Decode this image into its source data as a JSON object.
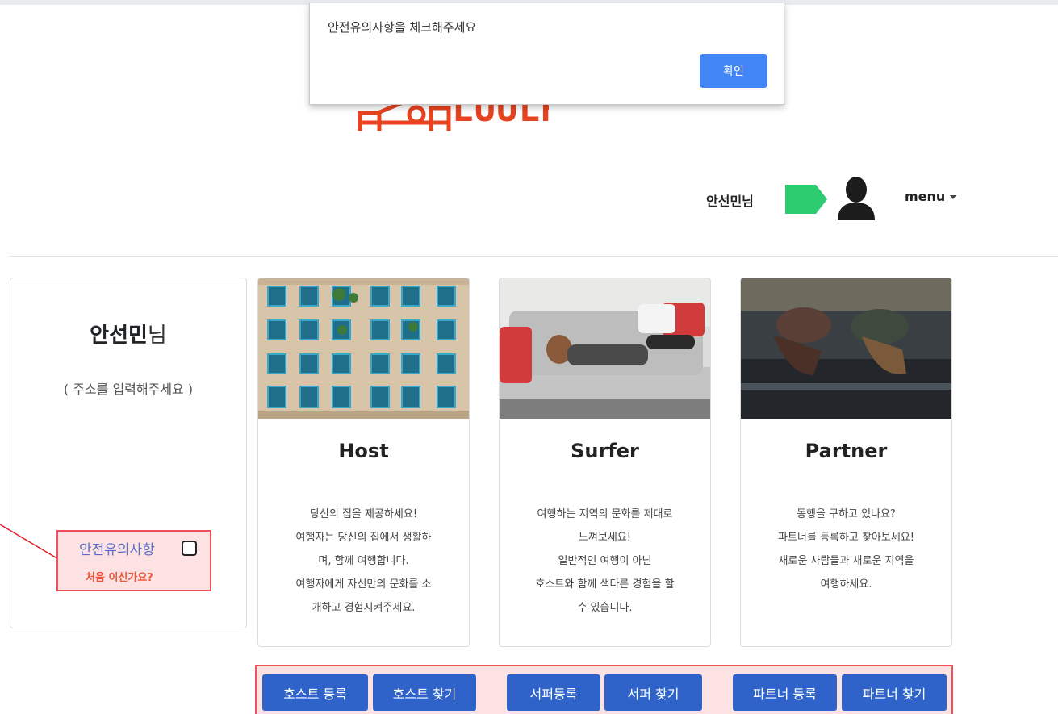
{
  "alert": {
    "message": "안전유의사항을 체크해주세요",
    "ok_label": "확인"
  },
  "logo": {
    "text": "LUULH"
  },
  "user_bar": {
    "user_name": "안선민님",
    "menu_label": "menu"
  },
  "profile": {
    "name": "안선민",
    "name_suffix": "님",
    "address": "( 주소를 입력해주세요 )",
    "safety_label": "안전유의사항",
    "first_time": "처음 이신가요?"
  },
  "cards": [
    {
      "title": "Host",
      "description": "당신의 집을 제공하세요!\n여행자는 당신의 집에서 생활하\n며, 함께 여행합니다.\n여행자에게 자신만의 문화를 소\n개하고 경험시켜주세요."
    },
    {
      "title": "Surfer",
      "description": "여행하는 지역의 문화를 제대로\n느껴보세요!\n일반적인 여행이 아닌\n호스트와 함께 색다른 경험을 할\n수 있습니다."
    },
    {
      "title": "Partner",
      "description": "동행을 구하고 있나요?\n파트너를 등록하고 찾아보세요!\n새로운 사람들과 새로운 지역을\n여행하세요."
    }
  ],
  "buttons": {
    "host_register": "호스트 등록",
    "host_find": "호스트 찾기",
    "surfer_register": "서퍼등록",
    "surfer_find": "서퍼 찾기",
    "partner_register": "파트너 등록",
    "partner_find": "파트너 찾기"
  },
  "colors": {
    "accent_blue": "#2f63c9",
    "alert_button": "#4285f4",
    "logo_orange": "#e8431f",
    "chat_green": "#2ecc71",
    "highlight_red": "#f0505a"
  }
}
